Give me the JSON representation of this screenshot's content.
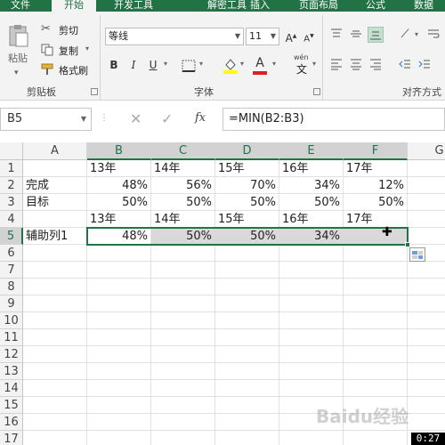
{
  "ribbon_tabs": [
    "文件",
    "开始",
    "开发工具",
    "解密工具",
    "插入",
    "页面布局",
    "公式",
    "数据"
  ],
  "active_tab": "开始",
  "clipboard": {
    "paste": "粘贴",
    "cut": "剪切",
    "copy": "复制",
    "format_painter": "格式刷",
    "group": "剪贴板"
  },
  "font": {
    "name": "等线",
    "size": "11",
    "group": "字体",
    "wen": "wén",
    "wen_char": "文"
  },
  "alignment": {
    "group": "对齐方式"
  },
  "namebox": "B5",
  "formula": "=MIN(B2:B3)",
  "fx_label": "fx",
  "columns": [
    "A",
    "B",
    "C",
    "D",
    "E",
    "F",
    "G"
  ],
  "rows": [
    "1",
    "2",
    "3",
    "4",
    "5",
    "6",
    "7",
    "8",
    "9",
    "10",
    "11",
    "12",
    "13",
    "14",
    "15",
    "16",
    "17"
  ],
  "cells": {
    "r1": [
      "",
      "13年",
      "14年",
      "15年",
      "16年",
      "17年"
    ],
    "r2": [
      "完成",
      "48%",
      "56%",
      "70%",
      "34%",
      "12%"
    ],
    "r3": [
      "目标",
      "50%",
      "50%",
      "50%",
      "50%",
      "50%"
    ],
    "r4": [
      "",
      "13年",
      "14年",
      "15年",
      "16年",
      "17年"
    ],
    "r5": [
      "辅助列1",
      "48%",
      "50%",
      "50%",
      "34%",
      ""
    ]
  },
  "timer": "0:27",
  "watermark": "Baidu经验",
  "colors": {
    "accent": "#217346",
    "ribbon_bg": "#f3f3f3"
  }
}
